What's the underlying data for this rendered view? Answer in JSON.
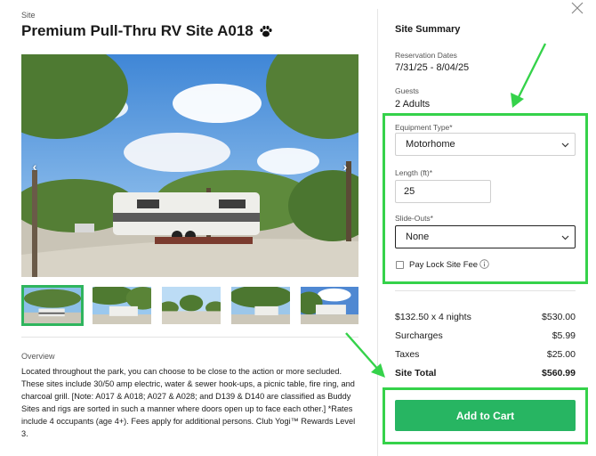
{
  "site": {
    "eyebrow": "Site",
    "title": "Premium Pull-Thru RV Site A018",
    "title_icon": "paw-print-icon"
  },
  "gallery": {
    "prev_icon": "chevron-left-icon",
    "next_icon": "chevron-right-icon",
    "prev_glyph": "‹",
    "next_glyph": "›",
    "thumbnail_count": 5,
    "selected_index": 0
  },
  "overview": {
    "label": "Overview",
    "text": "Located throughout the park, you can choose to be close to the action or more secluded. These sites include 30/50 amp electric, water & sewer hook-ups, a picnic table, fire ring, and charcoal grill. [Note: A017 & A018; A027 & A028; and D139 & D140 are classified as Buddy Sites and rigs are sorted in such a manner where doors open up to face each other.] *Rates include 4 occupants (age 4+). Fees apply for additional persons. Club Yogi™ Rewards Level 3."
  },
  "summary": {
    "title": "Site Summary",
    "reservation_label": "Reservation Dates",
    "reservation_value": "7/31/25 - 8/04/25",
    "guests_label": "Guests",
    "guests_value": "2 Adults",
    "equipment_label": "Equipment Type*",
    "equipment_value": "Motorhome",
    "length_label": "Length (ft)*",
    "length_value": "25",
    "slideouts_label": "Slide-Outs*",
    "slideouts_value": "None",
    "pay_lock_label": "Pay Lock Site Fee",
    "pay_lock_checked": false
  },
  "pricing": {
    "nights_label": "$132.50 x 4 nights",
    "nights_value": "$530.00",
    "surcharges_label": "Surcharges",
    "surcharges_value": "$5.99",
    "taxes_label": "Taxes",
    "taxes_value": "$25.00",
    "total_label": "Site Total",
    "total_value": "$560.99"
  },
  "actions": {
    "add_to_cart": "Add to Cart",
    "close_icon": "close-icon"
  },
  "colors": {
    "accent_green": "#27b562",
    "annotation_green": "#35d24a",
    "thumb_selected": "#2fb55e"
  }
}
